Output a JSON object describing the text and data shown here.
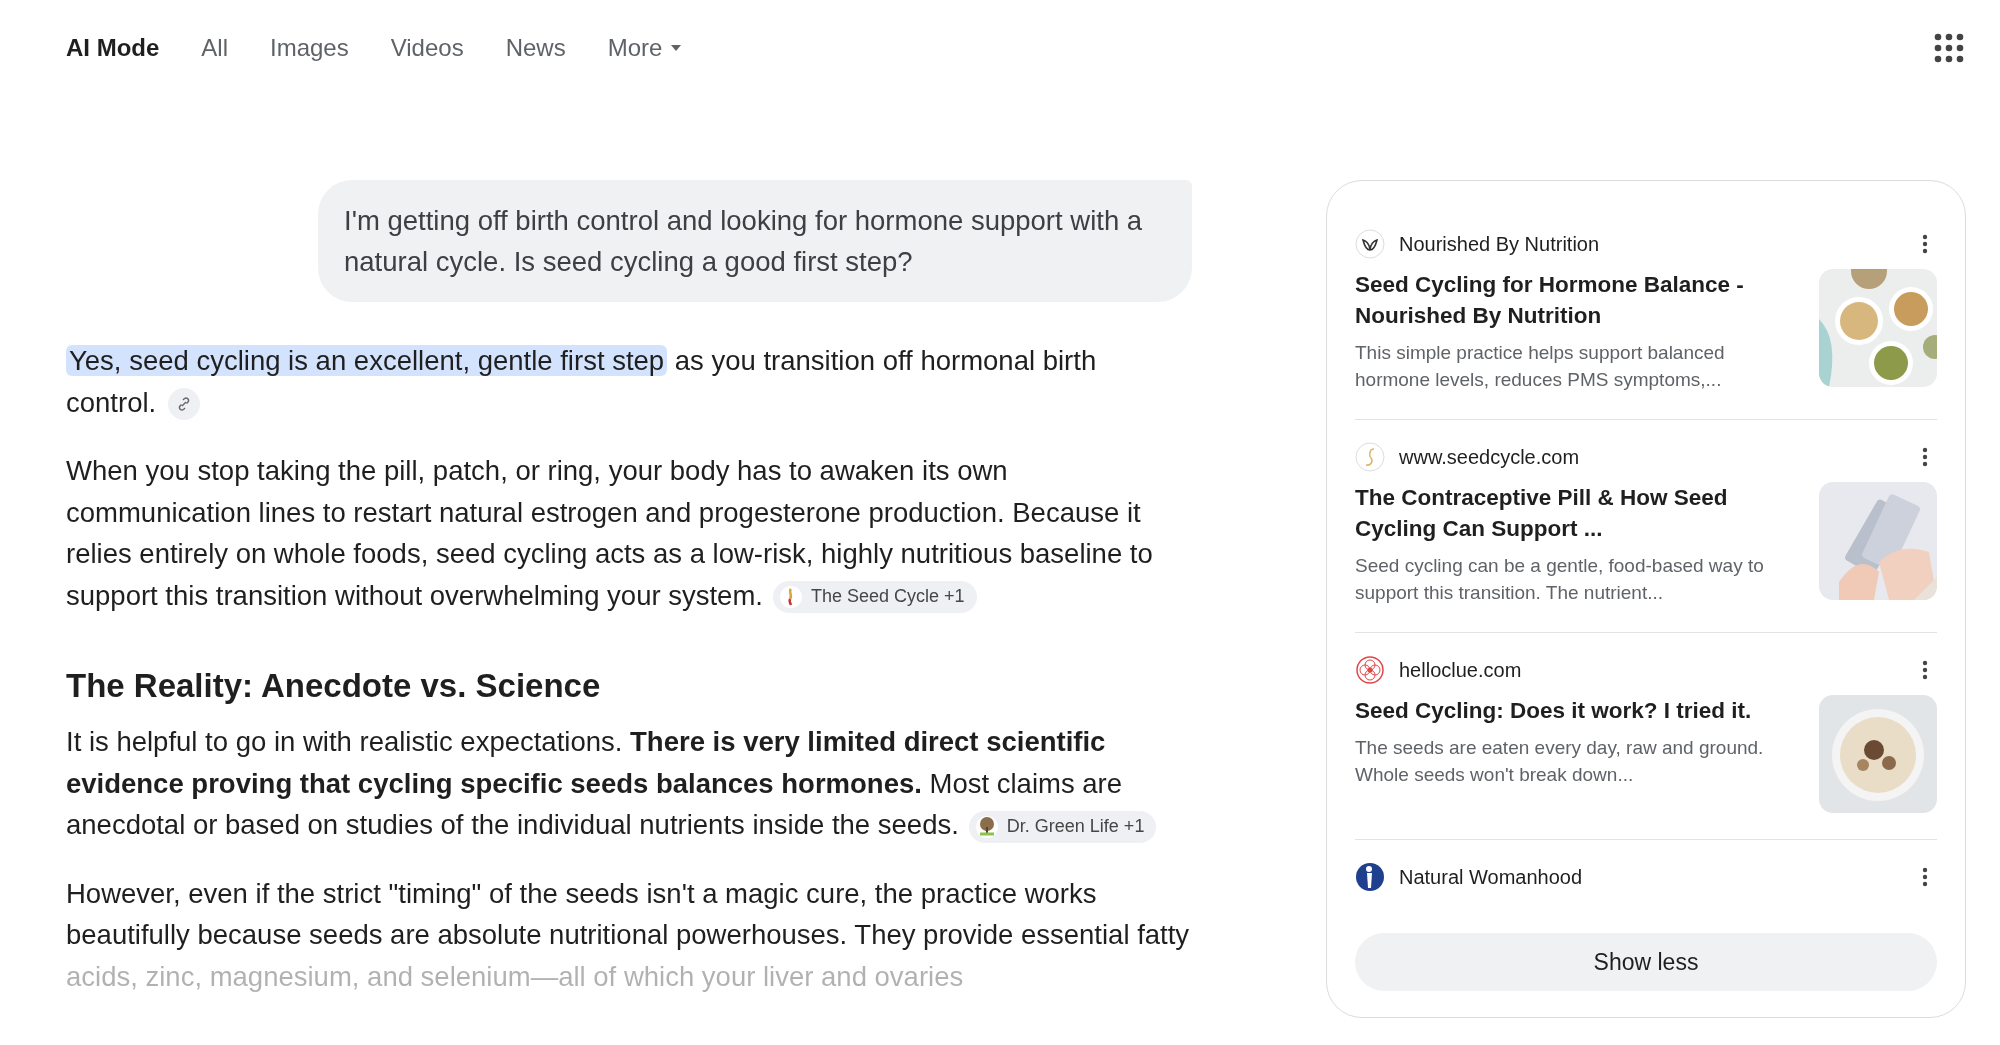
{
  "nav": {
    "tabs": [
      {
        "label": "AI Mode",
        "selected": true
      },
      {
        "label": "All",
        "selected": false
      },
      {
        "label": "Images",
        "selected": false
      },
      {
        "label": "Videos",
        "selected": false
      },
      {
        "label": "News",
        "selected": false
      },
      {
        "label": "More",
        "selected": false,
        "dropdown": true
      }
    ]
  },
  "query": "I'm getting off birth control and looking for hormone support with a natural cycle. Is seed cycling a good first step?",
  "answer": [
    {
      "kind": "intro",
      "highlight": "Yes, seed cycling is an excellent, gentle first step",
      "text": "as you transition off hormonal birth control.",
      "link": true
    },
    {
      "kind": "paragraph",
      "text": "When you stop taking the pill, patch, or ring, your body has to awaken its own communication lines to restart natural estrogen and progesterone production. Because it relies entirely on whole foods, seed cycling acts as a low-risk, highly nutritious baseline to support this transition without overwhelming your system.",
      "source": "The Seed Cycle +1"
    },
    {
      "kind": "heading",
      "text": "The Reality: Anecdote vs. Science"
    },
    {
      "kind": "paragraph",
      "text": "It is helpful to go in with realistic expectations. **There is very limited direct scientific evidence proving that cycling specific seeds balances hormones.** Most claims are anecdotal or based on studies of the individual nutrients inside the seeds.",
      "source": "Dr. Green Life +1"
    },
    {
      "kind": "faded",
      "text": "However, even if the strict \"timing\" of the seeds isn't a magic cure, the practice works beautifully because seeds are absolute nutritional powerhouses. They provide essential fatty acids, zinc, magnesium, and selenium—all of which your liver and ovaries"
    }
  ],
  "sources": {
    "items": [
      {
        "site": "Nourished By Nutrition",
        "title": "Seed Cycling for Hormone Balance - Nourished By Nutrition",
        "snippet": "This simple practice helps support balanced hormone levels, reduces PMS symptoms,...",
        "kind": "picture"
      },
      {
        "site": "www.seedcycle.com",
        "title": "The Contraceptive Pill & How Seed Cycling Can Support ...",
        "snippet": "Seed cycling can be a gentle, food-based way to support this transition. The nutrient...",
        "kind": "picture"
      },
      {
        "site": "helloclue.com",
        "title": "Seed Cycling: Does it work? I tried it.",
        "snippet": "The seeds are eaten every day, raw and ground. Whole seeds won't break down...",
        "kind": "picture"
      },
      {
        "site": "Natural Womanhood"
      }
    ],
    "button": "Show less"
  }
}
